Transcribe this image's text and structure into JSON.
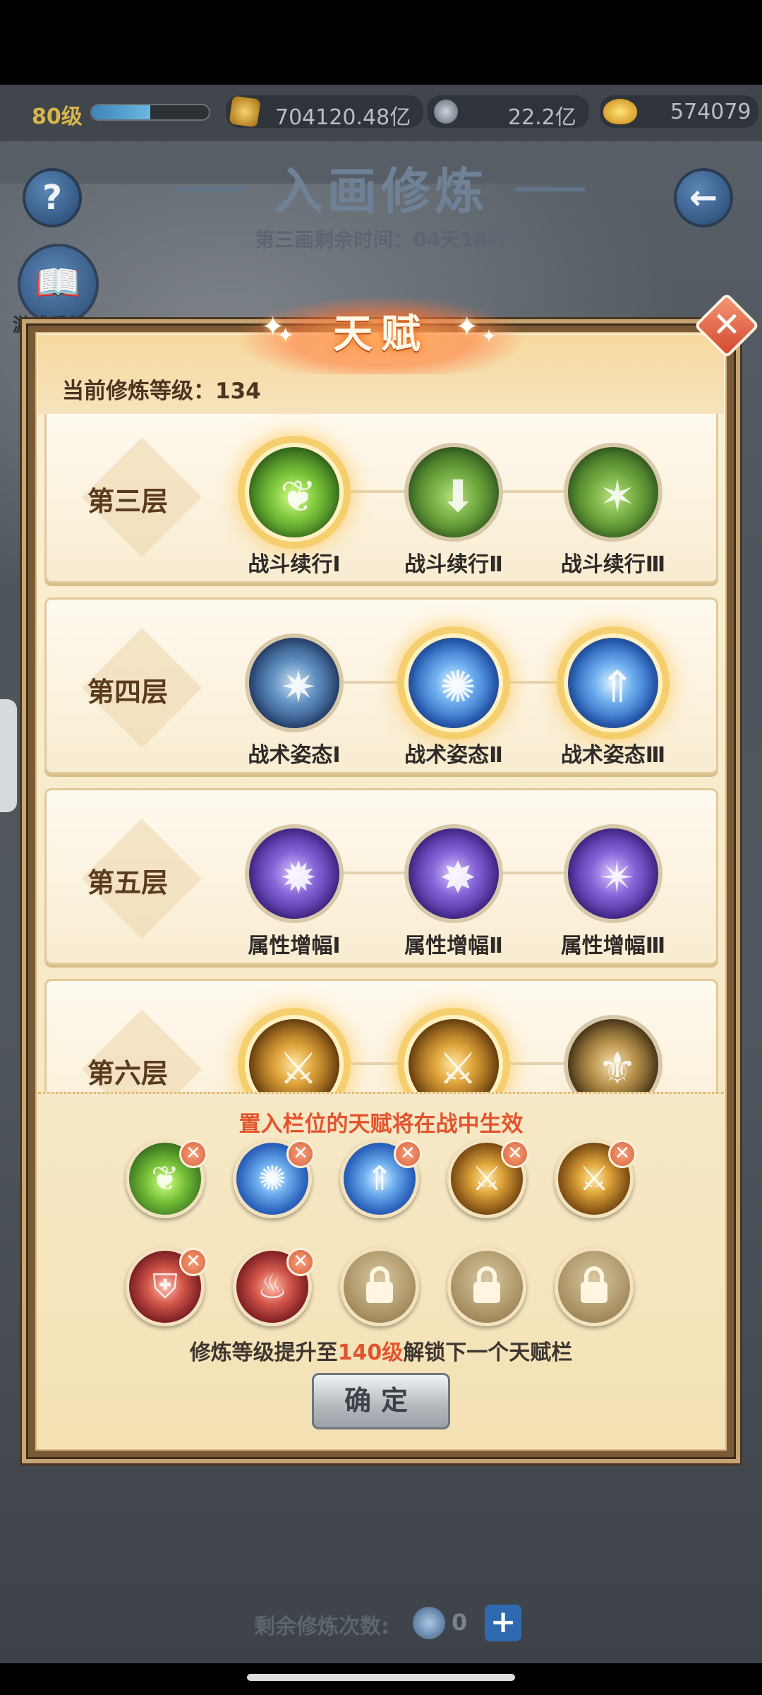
{
  "resources": {
    "level": "80级",
    "exp_progress": 0.5,
    "power": "704120.48亿",
    "coin": "22.2亿",
    "gold": "574079"
  },
  "header": {
    "help_glyph": "?",
    "title": "入画修炼",
    "subtitle": "第三画剩余时间：04天18时",
    "back_glyph": "←",
    "book_label": "游戏手册"
  },
  "modal": {
    "title": "天赋",
    "close_glyph": "✕",
    "current_level": "当前修炼等级：134",
    "tiers": [
      {
        "label": "第三层",
        "nodes": [
          "战斗续行Ⅰ",
          "战斗续行Ⅱ",
          "战斗续行Ⅲ"
        ],
        "selected": [
          true,
          false,
          false
        ]
      },
      {
        "label": "第四层",
        "nodes": [
          "战术姿态Ⅰ",
          "战术姿态Ⅱ",
          "战术姿态Ⅲ"
        ],
        "selected": [
          false,
          true,
          true
        ]
      },
      {
        "label": "第五层",
        "nodes": [
          "属性增幅Ⅰ",
          "属性增幅Ⅱ",
          "属性增幅Ⅲ"
        ],
        "selected": [
          false,
          false,
          false
        ]
      },
      {
        "label": "第六层",
        "nodes": [
          "",
          "",
          ""
        ],
        "selected": [
          true,
          true,
          false
        ]
      }
    ],
    "slot_hint": "置入栏位的天赋将在战中生效",
    "unlock_prefix": "修炼等级提升至",
    "unlock_level": "140级",
    "unlock_suffix": "解锁下一个天赋栏",
    "confirm": "确定"
  },
  "footer": {
    "remaining_label": "剩余修炼次数:",
    "remaining_count": "0",
    "plus": "+"
  },
  "icons": {
    "help": "question-icon",
    "back": "arrow-back-icon",
    "book": "book-icon",
    "power": "power-icon",
    "coin": "coin-icon",
    "gold": "gold-ingot-icon",
    "close": "close-icon",
    "lock": "lock-icon"
  },
  "colors": {
    "highlight": "#e2542e",
    "selected_glow": "#f5cf6d",
    "panel_bg": "#fbf0d6"
  }
}
